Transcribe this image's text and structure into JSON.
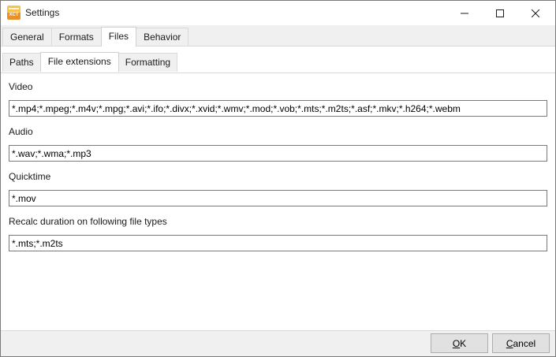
{
  "window": {
    "title": "Settings",
    "app_icon_text": "XCT",
    "controls": {
      "minimize": "minimize-icon",
      "maximize": "maximize-icon",
      "close": "close-icon"
    }
  },
  "main_tabs": [
    {
      "label": "General",
      "active": false
    },
    {
      "label": "Formats",
      "active": false
    },
    {
      "label": "Files",
      "active": true
    },
    {
      "label": "Behavior",
      "active": false
    }
  ],
  "sub_tabs": [
    {
      "label": "Paths",
      "active": false
    },
    {
      "label": "File extensions",
      "active": true
    },
    {
      "label": "Formatting",
      "active": false
    }
  ],
  "fields": {
    "video": {
      "label": "Video",
      "value": "*.mp4;*.mpeg;*.m4v;*.mpg;*.avi;*.ifo;*.divx;*.xvid;*.wmv;*.mod;*.vob;*.mts;*.m2ts;*.asf;*.mkv;*.h264;*.webm"
    },
    "audio": {
      "label": "Audio",
      "value": "*.wav;*.wma;*.mp3"
    },
    "quicktime": {
      "label": "Quicktime",
      "value": "*.mov"
    },
    "recalc": {
      "label": "Recalc duration on following file types",
      "value": "*.mts;*.m2ts"
    }
  },
  "buttons": {
    "ok": {
      "mnemonic": "O",
      "rest": "K"
    },
    "cancel": {
      "mnemonic": "C",
      "rest": "ancel"
    }
  }
}
